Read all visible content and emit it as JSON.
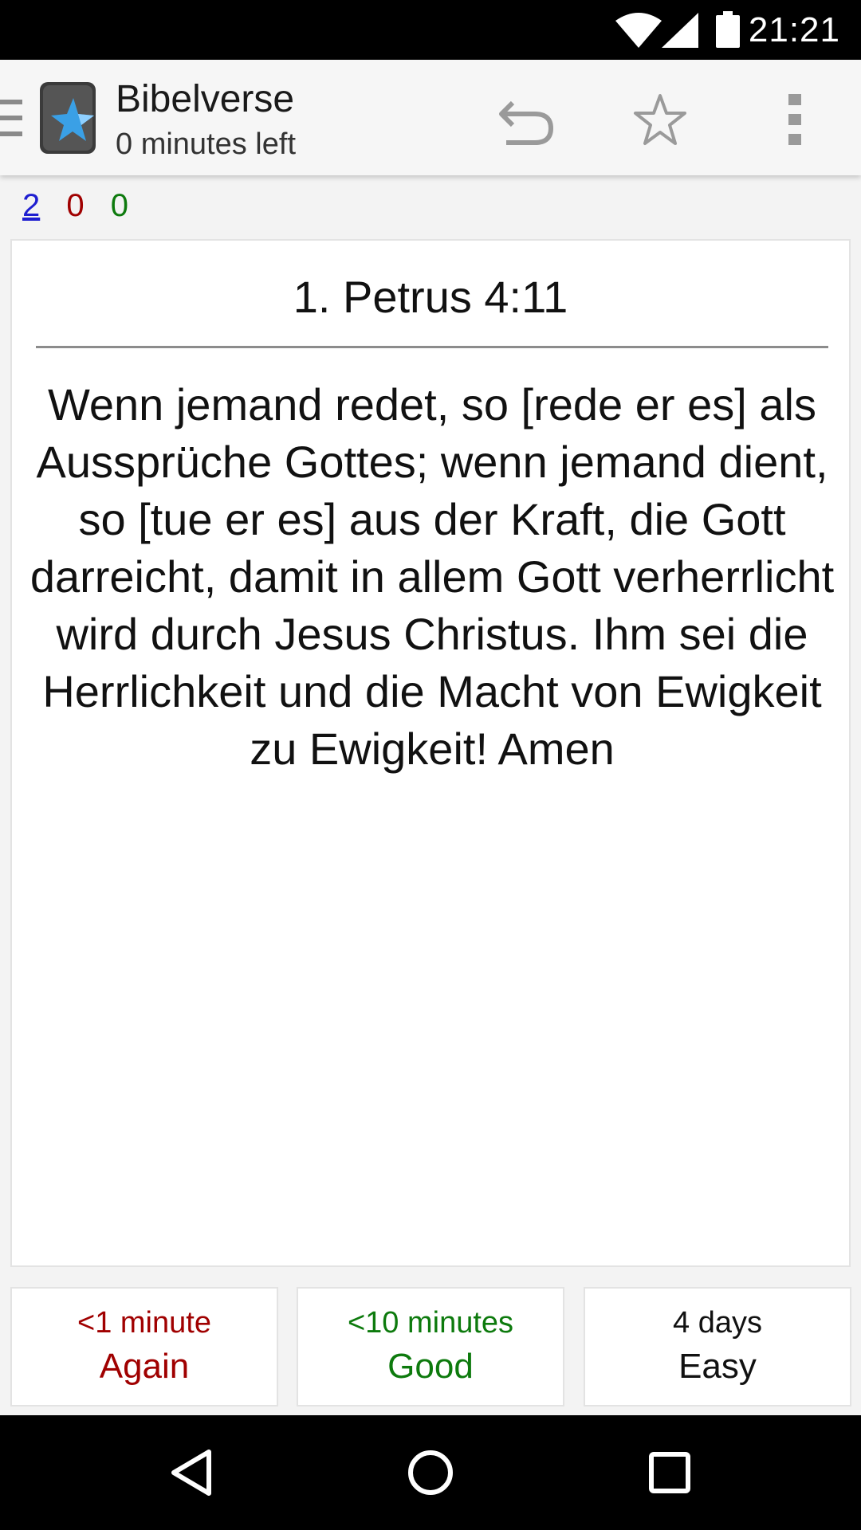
{
  "status_bar": {
    "time": "21:21",
    "icons": [
      "wifi-icon",
      "signal-icon",
      "battery-icon"
    ]
  },
  "app_bar": {
    "title": "Bibelverse",
    "subtitle": "0 minutes left",
    "icons": [
      "drawer-icon",
      "app-logo-icon",
      "undo-icon",
      "star-icon",
      "overflow-icon"
    ]
  },
  "counts": {
    "new": "2",
    "learning": "0",
    "review": "0"
  },
  "card": {
    "front": "1. Petrus 4:11",
    "back": "Wenn jemand redet, so [rede er es] als Aussprüche Gottes; wenn jemand dient, so [tue er es] aus der Kraft, die Gott darreicht, damit in allem Gott verherrlicht wird durch Jesus Christus. Ihm sei die Herrlichkeit und die Macht von Ewigkeit zu Ewigkeit! Amen"
  },
  "answers": [
    {
      "interval": "<1 minute",
      "label": "Again"
    },
    {
      "interval": "<10 minutes",
      "label": "Good"
    },
    {
      "interval": "4 days",
      "label": "Easy"
    }
  ],
  "colors": {
    "again": "#a00000",
    "good": "#0d7a0d",
    "new": "#1e1ed0"
  },
  "nav_bar": {
    "icons": [
      "back-icon",
      "home-icon",
      "recents-icon"
    ]
  }
}
